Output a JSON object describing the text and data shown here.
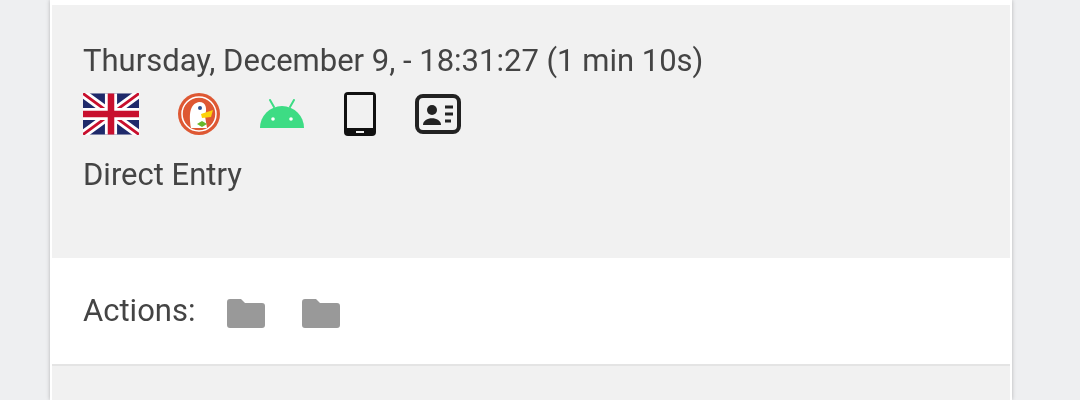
{
  "visit": {
    "datetime": "Thursday, December 9, - 18:31:27 (1 min 10s)",
    "referrer": "Direct Entry"
  },
  "actions": {
    "label": "Actions:"
  }
}
